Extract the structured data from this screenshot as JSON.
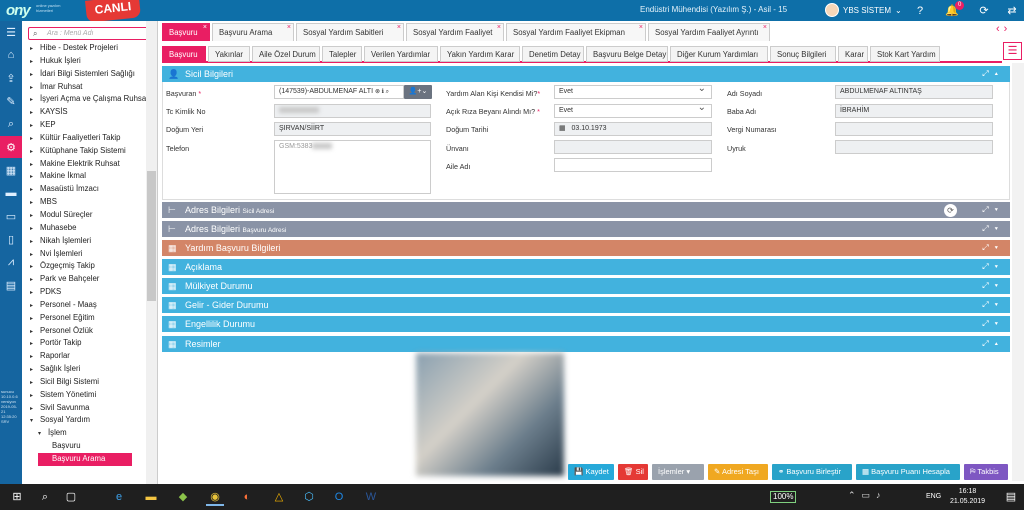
{
  "app": {
    "logo": "ony",
    "logo_sub": "online yazılım hizmetleri",
    "live_badge": "CANLI",
    "title": "Endüstri Mühendisi (Yazılım Ş.) - Asil - 15",
    "user": "YBS SİSTEM",
    "notification_count": "0"
  },
  "sidebar_info": "sunucu 10.10.0.6 versiyon 2019-05-21 12:35:20 SRV",
  "menu": {
    "search_placeholder": "Ara : Menü Adı",
    "items": [
      {
        "label": "Hibe - Destek Projeleri",
        "level": 0
      },
      {
        "label": "Hukuk İşleri",
        "level": 0
      },
      {
        "label": "İdari Bilgi Sistemleri Sağlığı",
        "level": 0
      },
      {
        "label": "İmar Ruhsat",
        "level": 0
      },
      {
        "label": "İşyeri Açma ve Çalışma Ruhsatı",
        "level": 0
      },
      {
        "label": "KAYSİS",
        "level": 0
      },
      {
        "label": "KEP",
        "level": 0
      },
      {
        "label": "Kültür Faaliyetleri Takip",
        "level": 0
      },
      {
        "label": "Kütüphane Takip Sistemi",
        "level": 0
      },
      {
        "label": "Makine Elektrik Ruhsat",
        "level": 0
      },
      {
        "label": "Makine İkmal",
        "level": 0
      },
      {
        "label": "Masaüstü İmzacı",
        "level": 0
      },
      {
        "label": "MBS",
        "level": 0
      },
      {
        "label": "Modul Süreçler",
        "level": 0
      },
      {
        "label": "Muhasebe",
        "level": 0
      },
      {
        "label": "Nikah İşlemleri",
        "level": 0
      },
      {
        "label": "Nvi İşlemleri",
        "level": 0
      },
      {
        "label": "Özgeçmiş Takip",
        "level": 0
      },
      {
        "label": "Park ve Bahçeler",
        "level": 0
      },
      {
        "label": "PDKS",
        "level": 0
      },
      {
        "label": "Personel - Maaş",
        "level": 0
      },
      {
        "label": "Personel Eğitim",
        "level": 0
      },
      {
        "label": "Personel Özlük",
        "level": 0
      },
      {
        "label": "Portör Takip",
        "level": 0
      },
      {
        "label": "Raporlar",
        "level": 0
      },
      {
        "label": "Sağlık İşleri",
        "level": 0
      },
      {
        "label": "Sicil Bilgi Sistemi",
        "level": 0
      },
      {
        "label": "Sistem Yönetimi",
        "level": 0
      },
      {
        "label": "Sivil Savunma",
        "level": 0
      },
      {
        "label": "Sosyal Yardım",
        "level": 0,
        "open": true
      },
      {
        "label": "İşlem",
        "level": 1,
        "open": true
      },
      {
        "label": "Başvuru",
        "level": 2
      },
      {
        "label": "Başvuru Arama",
        "level": 2,
        "selected": true
      }
    ]
  },
  "tabs_main": [
    {
      "label": "Başvuru",
      "active": true
    },
    {
      "label": "Başvuru Arama"
    },
    {
      "label": "Sosyal Yardım Sabitleri"
    },
    {
      "label": "Sosyal Yardım Faaliyet"
    },
    {
      "label": "Sosyal Yardım Faaliyet Ekipman"
    },
    {
      "label": "Sosyal Yardım Faaliyet Ayrıntı"
    }
  ],
  "tabs_sub": [
    {
      "label": "Başvuru",
      "active": true
    },
    {
      "label": "Yakınlar"
    },
    {
      "label": "Aile Özel Durum"
    },
    {
      "label": "Talepler"
    },
    {
      "label": "Verilen Yardımlar"
    },
    {
      "label": "Yakın Yardım Karar"
    },
    {
      "label": "Denetim Detay"
    },
    {
      "label": "Başvuru Belge Detay"
    },
    {
      "label": "Diğer Kurum Yardımları"
    },
    {
      "label": "Sonuç Bilgileri"
    },
    {
      "label": "Karar"
    },
    {
      "label": "Stok Kart Yardım"
    }
  ],
  "sicil": {
    "title": "Sicil Bilgileri",
    "basvuran_label": "Başvuran",
    "basvuran_value": "(147539)-ABDULMENAF ALTI",
    "tc_label": "Tc Kimlik No",
    "dogum_yeri_label": "Doğum Yeri",
    "dogum_yeri_value": "ŞIRVAN/SİİRT",
    "telefon_label": "Telefon",
    "telefon_value": "GSM:5383",
    "yardim_alan_label": "Yardım Alan Kişi Kendisi Mi?",
    "yardim_alan_value": "Evet",
    "acik_riza_label": "Açık Rıza Beyanı Alındı Mı?",
    "acik_riza_value": "Evet",
    "dogum_tarihi_label": "Doğum Tarihi",
    "dogum_tarihi_value": "03.10.1973",
    "unvani_label": "Ünvanı",
    "aile_adi_label": "Aile Adı",
    "adi_soyadi_label": "Adı Soyadı",
    "adi_soyadi_value": "ABDULMENAF ALTINTAŞ",
    "baba_adi_label": "Baba Adı",
    "baba_adi_value": "İBRAHİM",
    "vergi_label": "Vergi Numarası",
    "uyruk_label": "Uyruk"
  },
  "panels": [
    {
      "title": "Adres Bilgileri",
      "sub": "Sicil Adresi"
    },
    {
      "title": "Adres Bilgileri",
      "sub": "Başvuru Adresi"
    },
    {
      "title": "Yardım Başvuru Bilgileri",
      "sub": ""
    },
    {
      "title": "Açıklama",
      "sub": ""
    },
    {
      "title": "Mülkiyet Durumu",
      "sub": ""
    },
    {
      "title": "Gelir - Gider Durumu",
      "sub": ""
    },
    {
      "title": "Engellilik Durumu",
      "sub": ""
    },
    {
      "title": "Resimler",
      "sub": ""
    }
  ],
  "actions": {
    "kaydet": "Kaydet",
    "sil": "Sil",
    "islemler": "İşlemler",
    "adresi_tasi": "Adresi Taşı",
    "basvuru_birlestir": "Başvuru Birleştir",
    "basvuru_puani": "Başvuru Puanı Hesapla",
    "takbis": "Takbis"
  },
  "taskbar": {
    "battery": "100%",
    "lang": "ENG",
    "time": "16:18",
    "date": "21.05.2019"
  }
}
